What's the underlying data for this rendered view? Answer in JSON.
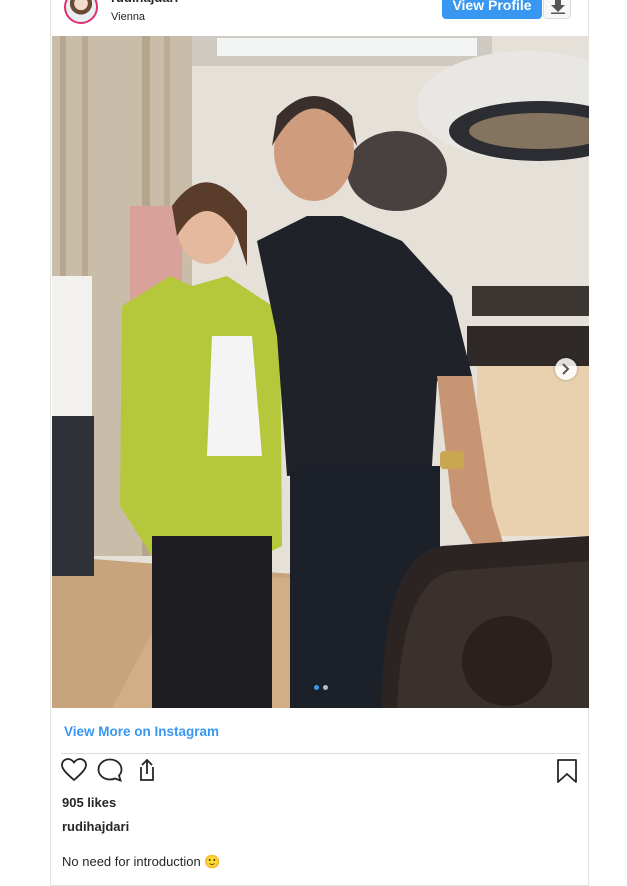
{
  "post": {
    "username": "rudihajdari",
    "location": "Vienna",
    "view_profile_label": "View Profile",
    "view_more_label": "View More on Instagram",
    "likes": "905 likes",
    "caption_user": "rudihajdari",
    "caption_text": "No need for introduction 🙂",
    "carousel": {
      "slides": 2,
      "active_slide": 1
    }
  },
  "icons": {
    "download": "download-icon",
    "next": "chevron-right-icon",
    "like": "heart-icon",
    "comment": "comment-icon",
    "share": "share-icon",
    "save": "bookmark-icon"
  },
  "colors": {
    "accent": "#3897f0",
    "text": "#262626",
    "border": "#dbdbdb"
  }
}
